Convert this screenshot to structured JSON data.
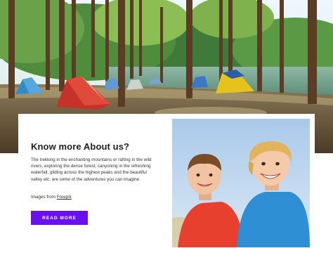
{
  "about": {
    "heading": "Know more About us?",
    "description": "The trekking in the enchanting mountains or rafting in the wild rivers, exploring the dense forest, canyoning in the refreshing waterfall, gliding across the highest peaks and the beautiful valley etc. are some of the adventures you can imagine.",
    "credit_prefix": "Images from ",
    "credit_link": "Freepik",
    "button_label": "READ MORE"
  },
  "colors": {
    "accent": "#6a10f0",
    "text": "#1e1e1e"
  },
  "icons": {
    "hero_image": "forest-campsite-photo",
    "photo": "two-kids-photo"
  }
}
